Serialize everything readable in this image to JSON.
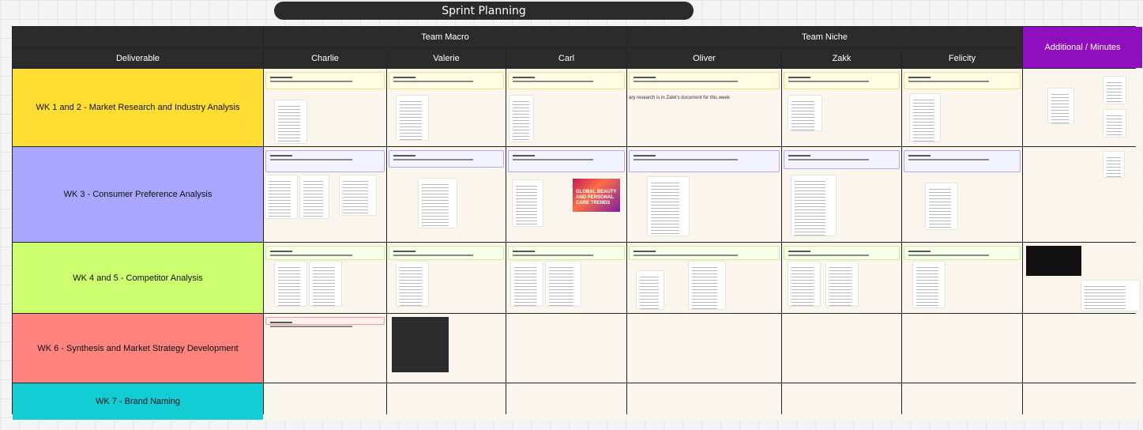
{
  "title": "Sprint Planning",
  "header": {
    "deliverable": "Deliverable",
    "team_macro": "Team Macro",
    "team_niche": "Team Niche",
    "additional": "Additional / Minutes",
    "members": [
      "Charlie",
      "Valerie",
      "Carl",
      "Oliver",
      "Zakk",
      "Felicity"
    ]
  },
  "rows": [
    {
      "label": "WK 1 and 2 - Market Research and Industry Analysis",
      "color": "#ffdd33"
    },
    {
      "label": "WK 3 - Consumer Preference Analysis",
      "color": "#a9a6fe"
    },
    {
      "label": "WK 4 and 5 - Competitor Analysis",
      "color": "#cdfe70"
    },
    {
      "label": "WK 6 - Synthesis and Market Strategy Development",
      "color": "#ff837f"
    },
    {
      "label": "WK 7 - Brand Naming",
      "color": "#12cdd4"
    }
  ],
  "oliver_wk1_note": "ary research is in Zakk's document for this week",
  "promo_text": "GLOBAL BEAUTY AND PERSONAL CARE TRENDS"
}
